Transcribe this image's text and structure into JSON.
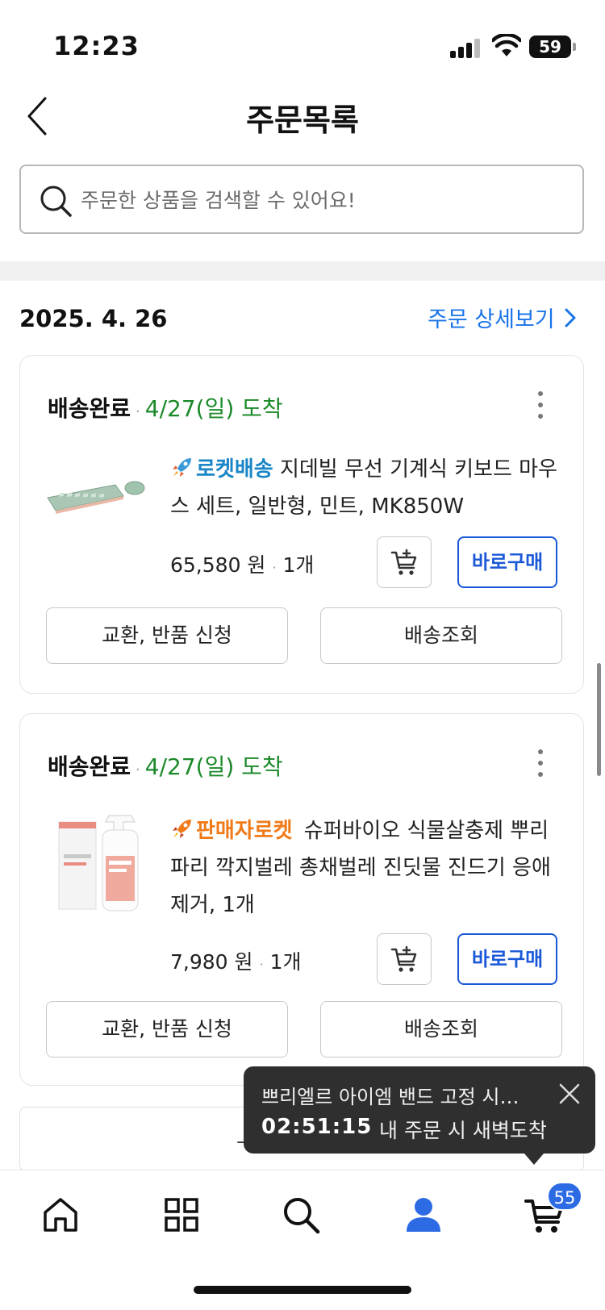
{
  "status_bar": {
    "time": "12:23",
    "battery": "59"
  },
  "header": {
    "title": "주문목록"
  },
  "search": {
    "placeholder": "주문한 상품을 검색할 수 있어요!"
  },
  "order_group": {
    "date": "2025. 4. 26",
    "detail_link": "주문 상세보기"
  },
  "orders": [
    {
      "status": "배송완료",
      "arrival": "4/27(일) 도착",
      "badge": "로켓배송",
      "product_name": "지데빌 무선 기계식 키보드 마우스 세트, 일반형, 민트, MK850W",
      "price": "65,580 원",
      "quantity": "1개",
      "buy_label": "바로구매",
      "exchange_label": "교환, 반품 신청",
      "tracking_label": "배송조회",
      "icons": {
        "thumb": "keyboard-mouse-thumbnail",
        "cart": "add-to-cart-icon"
      }
    },
    {
      "status": "배송완료",
      "arrival": "4/27(일) 도착",
      "badge": "판매자로켓",
      "product_name": "슈퍼바이오 식물살충제 뿌리파리 깍지벌레 총채벌레 진딧물 진드기 응애 제거, 1개",
      "price": "7,980 원",
      "quantity": "1개",
      "buy_label": "바로구매",
      "exchange_label": "교환, 반품 신청",
      "tracking_label": "배송조회",
      "icons": {
        "thumb": "spray-bottle-thumbnail",
        "cart": "add-to-cart-icon"
      }
    }
  ],
  "toast": {
    "title": "쁘리엘르 아이엠 밴드 고정 시…",
    "countdown": "02:51:15",
    "message": "내 주문 시 새벽도착"
  },
  "bottom_nav": {
    "items": [
      "home-icon",
      "category-icon",
      "search-icon",
      "my-coupang-icon",
      "cart-icon"
    ],
    "cart_count": "55",
    "active": "my-coupang-icon"
  },
  "colors": {
    "link_blue": "#1a73e8",
    "arrival_green": "#1c8a2a",
    "rocket_blue": "#1a86c7",
    "seller_orange": "#f07a18",
    "buy_blue": "#1a58d8",
    "badge_blue": "#2d6be4"
  }
}
